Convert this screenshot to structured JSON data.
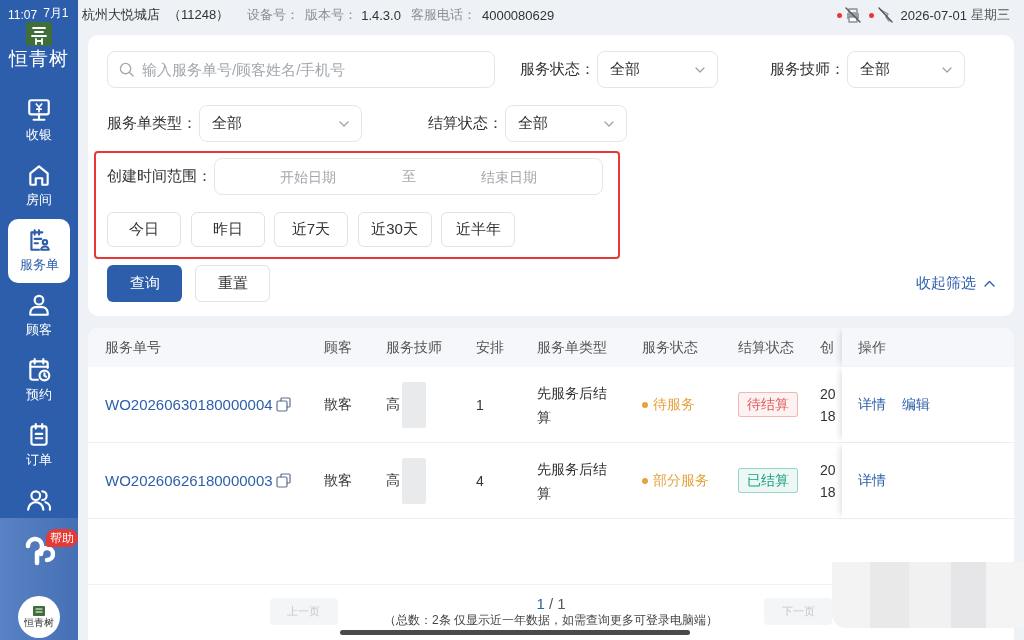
{
  "status_bar": {
    "time": "11:07",
    "date_cut": "7月1",
    "store": "杭州大悦城店",
    "store_code": "（11248）",
    "device_label": "设备号：",
    "version_label": "版本号：",
    "version": "1.4.3.0",
    "hotline_label": "客服电话：",
    "hotline": "4000080629",
    "indicators": [
      {
        "alert": true
      },
      {
        "alert": true
      }
    ],
    "date": "2026-07-01",
    "weekday": "星期三"
  },
  "sidebar": {
    "brand": "恒青树",
    "items": [
      {
        "label": "收银",
        "selected": false
      },
      {
        "label": "房间",
        "selected": false
      },
      {
        "label": "服务单",
        "selected": true
      },
      {
        "label": "顾客",
        "selected": false
      },
      {
        "label": "预约",
        "selected": false
      },
      {
        "label": "订单",
        "selected": false
      },
      {
        "selected": false
      }
    ],
    "help_badge": "帮助",
    "footer_logo": "恒青树"
  },
  "filters": {
    "search": {
      "placeholder": "输入服务单号/顾客姓名/手机号"
    },
    "selects": [
      {
        "label": "服务状态：",
        "value": "全部"
      },
      {
        "label": "服务技师：",
        "value": "全部"
      },
      {
        "label": "服务单类型：",
        "value": "全部"
      },
      {
        "label": "结算状态：",
        "value": "全部"
      }
    ],
    "date_range": {
      "label": "创建时间范围：",
      "start_placeholder": "开始日期",
      "separator": "至",
      "end_placeholder": "结束日期",
      "highlighted": true
    },
    "quick_ranges": [
      {
        "label": "今日",
        "selected": false
      },
      {
        "label": "昨日",
        "selected": false
      },
      {
        "label": "近7天",
        "selected": false
      },
      {
        "label": "近30天",
        "selected": false
      },
      {
        "label": "近半年",
        "selected": false
      }
    ],
    "buttons": [
      {
        "label": "查询",
        "kind": "primary"
      },
      {
        "label": "重置",
        "kind": "default"
      }
    ],
    "collapse": {
      "label": "收起筛选",
      "expanded": true
    }
  },
  "table": {
    "columns": [
      "服务单号",
      "顾客",
      "服务技师",
      "安排",
      "服务单类型",
      "服务状态",
      "结算状态",
      "创",
      "操作"
    ],
    "rows": [
      {
        "order_no": "WO20260630180000004",
        "customer": "散客",
        "technician": "高",
        "technician_redacted": true,
        "arrangement": "1",
        "type": "先服务后结算",
        "service_status": {
          "text": "待服务",
          "color": "#e6a23c"
        },
        "settlement": {
          "text": "待结算",
          "color": "#e05c5c"
        },
        "created": "20\n18",
        "actions": [
          "详情",
          "编辑"
        ]
      },
      {
        "order_no": "WO20260626180000003",
        "customer": "散客",
        "technician": "高",
        "technician_redacted": true,
        "arrangement": "4",
        "type": "先服务后结算",
        "service_status": {
          "text": "部分服务",
          "color": "#e6a23c"
        },
        "settlement": {
          "text": "已结算",
          "color": "#17a085"
        },
        "created": "20\n18",
        "actions": [
          "详情"
        ]
      }
    ]
  },
  "pagination": {
    "prev": "上一页",
    "prev_disabled": true,
    "current": "1",
    "separator": "/",
    "total": "1",
    "note": "（总数：2条 仅显示近一年数据，如需查询更多可登录电脑端）",
    "next": "下一页",
    "next_disabled": true
  }
}
